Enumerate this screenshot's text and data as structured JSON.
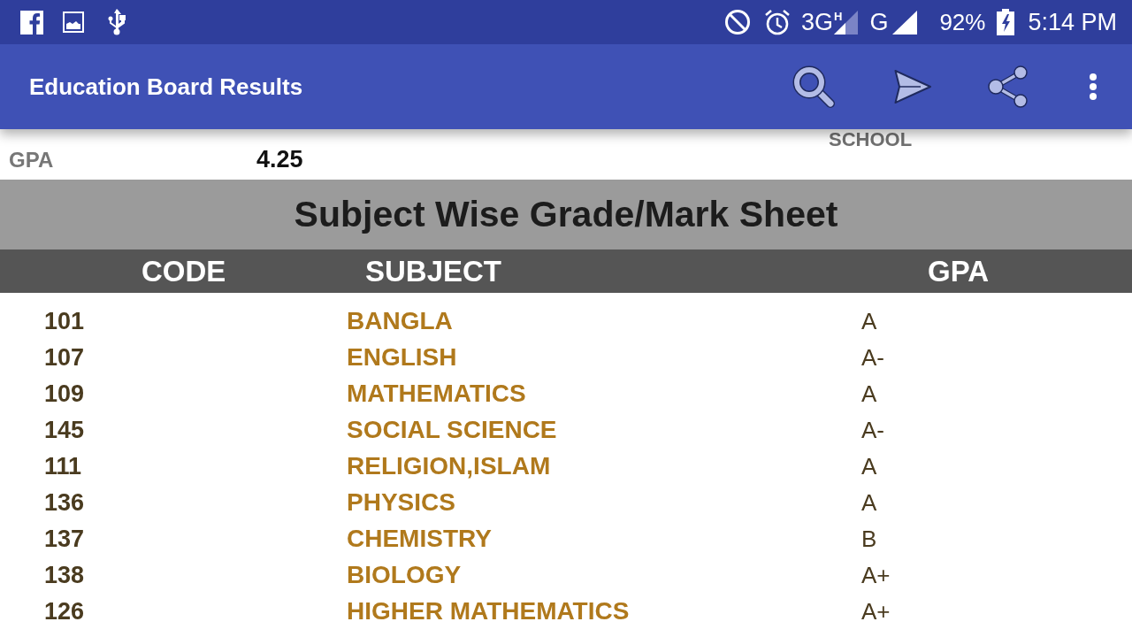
{
  "status_bar": {
    "network_type": "3G",
    "network_sub": "H",
    "network_type_2": "G",
    "battery": "92%",
    "time": "5:14 PM"
  },
  "app_bar": {
    "title": "Education Board Results"
  },
  "summary": {
    "partial_label": "SCHOOL",
    "gpa_label": "GPA",
    "gpa_value": "4.25"
  },
  "section_title": "Subject Wise Grade/Mark Sheet",
  "table": {
    "columns": [
      "CODE",
      "SUBJECT",
      "GPA"
    ],
    "rows": [
      {
        "code": "101",
        "subject": "BANGLA",
        "gpa": "A"
      },
      {
        "code": "107",
        "subject": "ENGLISH",
        "gpa": "A-"
      },
      {
        "code": "109",
        "subject": "MATHEMATICS",
        "gpa": "A"
      },
      {
        "code": "145",
        "subject": "SOCIAL SCIENCE",
        "gpa": "A-"
      },
      {
        "code": "111",
        "subject": "RELIGION,ISLAM",
        "gpa": "A"
      },
      {
        "code": "136",
        "subject": "PHYSICS",
        "gpa": "A"
      },
      {
        "code": "137",
        "subject": "CHEMISTRY",
        "gpa": "B"
      },
      {
        "code": "138",
        "subject": "BIOLOGY",
        "gpa": "A+"
      },
      {
        "code": "126",
        "subject": "HIGHER MATHEMATICS",
        "gpa": "A+"
      }
    ]
  }
}
